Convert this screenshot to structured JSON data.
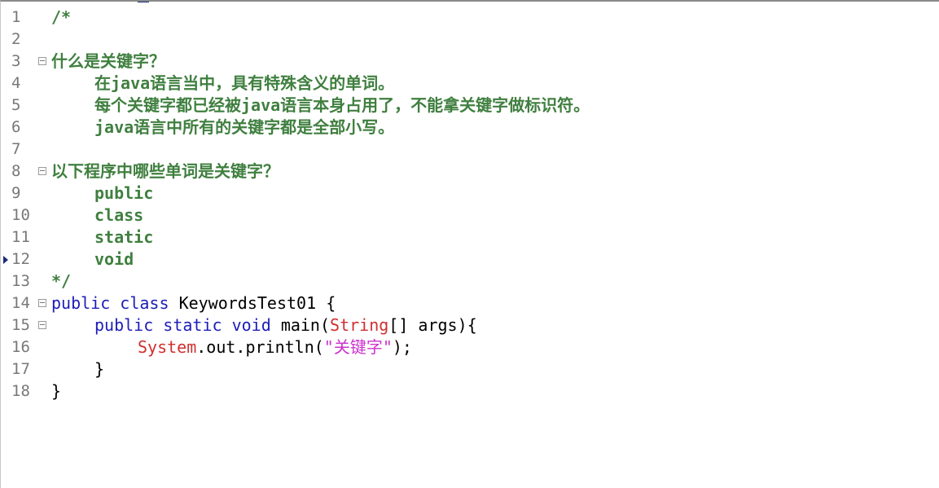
{
  "gutter": {
    "line_numbers": [
      "1",
      "2",
      "3",
      "4",
      "5",
      "6",
      "7",
      "8",
      "9",
      "10",
      "11",
      "12",
      "13",
      "14",
      "15",
      "16",
      "17",
      "18"
    ]
  },
  "code": {
    "comment": {
      "open": "/*",
      "heading1": "什么是关键字？",
      "line4": "在java语言当中，具有特殊含义的单词。",
      "line5": "每个关键字都已经被java语言本身占用了，不能拿关键字做标识符。",
      "line6": "java语言中所有的关键字都是全部小写。",
      "heading2": "以下程序中哪些单词是关键字？",
      "keywords": [
        "public",
        "class",
        "static",
        "void"
      ],
      "close": "*/"
    },
    "class_decl": {
      "modifier": "public",
      "keyword": "class",
      "name": "KeywordsTest01",
      "brace": "{"
    },
    "method_decl": {
      "modifier": "public",
      "static": "static",
      "return_type": "void",
      "name_open": "main(",
      "param_type": "String",
      "rest": "[] args){"
    },
    "statement": {
      "receiver": "System",
      "call": ".out.println(",
      "string": "\"关键字\"",
      "end": ");"
    },
    "method_close": "}",
    "class_close": "}"
  }
}
